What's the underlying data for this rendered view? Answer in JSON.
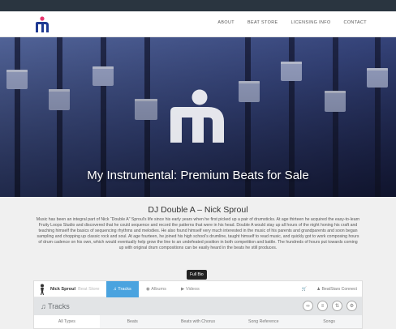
{
  "nav": {
    "items": [
      "ABOUT",
      "BEAT STORE",
      "LICENSING INFO",
      "CONTACT"
    ]
  },
  "hero": {
    "title": "My Instrumental: Premium Beats for Sale"
  },
  "bio": {
    "title": "DJ Double A – Nick Sproul",
    "text": "Music has been an integral part of Nick “Double A” Sproul’s life since his early years when he first picked up a pair of drumsticks. At age thirteen he acquired the easy-to-learn Fruity Loops Studio and discovered that he could sequence and record the patterns that were in his head. Double A would stay up all hours of the night honing his craft and teaching himself the basics of sequencing rhythms and melodies. He also found himself very much interested in the music of his parents and grandparents and soon began sampling and chopping up classic rock and soul. At age fourteen, he joined his high school’s drumline, taught himself to read music, and quickly got to work composing hours of drum cadence on his own, which would eventually help grow the line to an undefeated position in both competition and battle. The hundreds of hours put towards coming up with original drum compositions can be easily heard in the beats he still produces.",
    "full_bio_label": "Full Bio"
  },
  "player": {
    "artist": "Nick Sproul",
    "artist_sub": "Beat Store",
    "tabs": [
      "Tracks",
      "Albums",
      "Videos"
    ],
    "connect": "BeatStars Connect",
    "section_title": "Tracks",
    "types": [
      "All Types",
      "Beats",
      "Beats with Chorus",
      "Song Reference",
      "Songs"
    ]
  },
  "colors": {
    "accent": "#4aa3df",
    "nav_dark": "#2a3540",
    "logo_blue": "#1f3a93",
    "logo_pink": "#e8336d"
  }
}
